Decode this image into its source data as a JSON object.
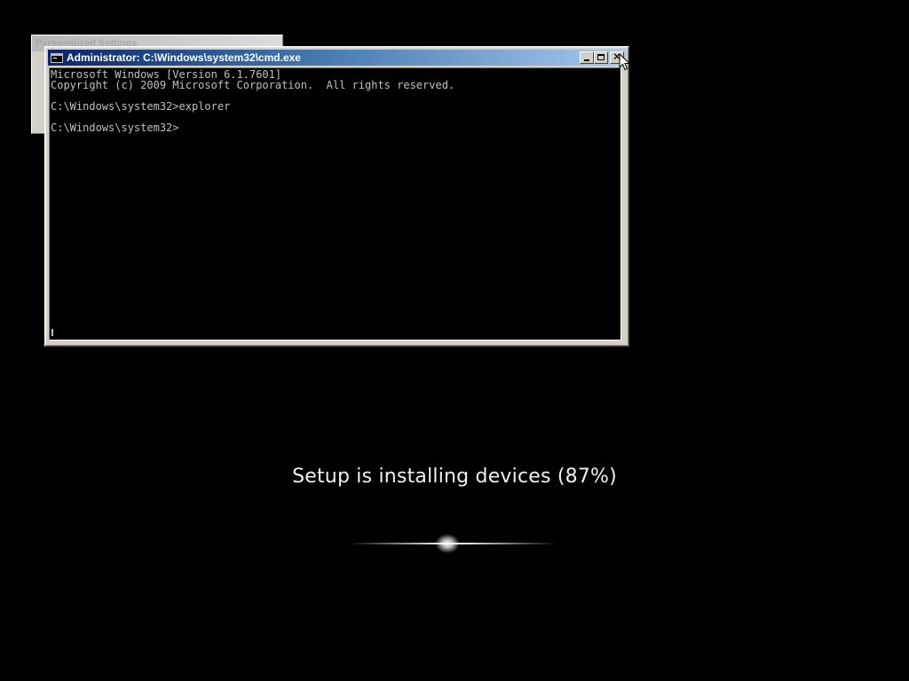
{
  "background_window": {
    "title": "Personalized Settings"
  },
  "cmd_window": {
    "title": "Administrator: C:\\Windows\\system32\\cmd.exe",
    "lines": [
      "Microsoft Windows [Version 6.1.7601]",
      "Copyright (c) 2009 Microsoft Corporation.  All rights reserved.",
      "",
      "C:\\Windows\\system32>explorer",
      "",
      "C:\\Windows\\system32>"
    ],
    "buttons": {
      "minimize_icon": "minimize-icon",
      "maximize_icon": "maximize-icon",
      "close_icon": "close-icon"
    }
  },
  "setup": {
    "status_text": "Setup is installing devices (87%)",
    "progress_percent": 87
  },
  "colors": {
    "background": "#000000",
    "titlebar_start": "#0a246a",
    "titlebar_end": "#a6caf0",
    "console_text": "#c0c0c0",
    "status_text": "#f0f0f0"
  }
}
